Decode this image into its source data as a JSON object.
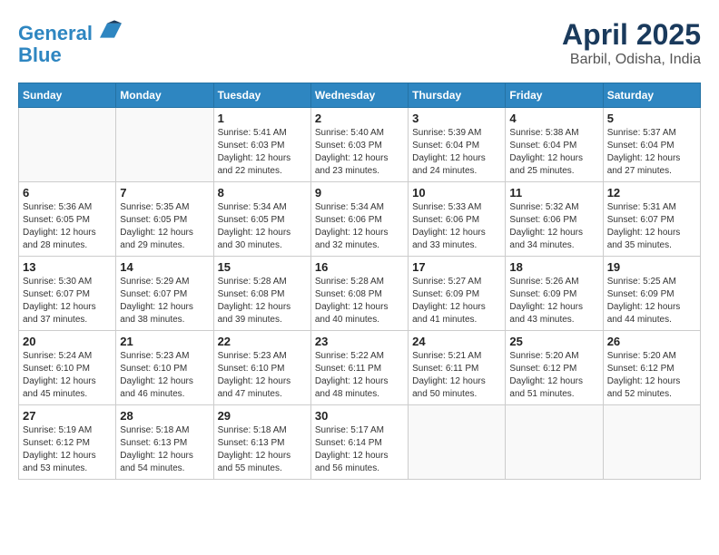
{
  "header": {
    "logo_line1": "General",
    "logo_line2": "Blue",
    "title": "April 2025",
    "subtitle": "Barbil, Odisha, India"
  },
  "weekdays": [
    "Sunday",
    "Monday",
    "Tuesday",
    "Wednesday",
    "Thursday",
    "Friday",
    "Saturday"
  ],
  "weeks": [
    [
      {
        "day": "",
        "info": ""
      },
      {
        "day": "",
        "info": ""
      },
      {
        "day": "1",
        "info": "Sunrise: 5:41 AM\nSunset: 6:03 PM\nDaylight: 12 hours and 22 minutes."
      },
      {
        "day": "2",
        "info": "Sunrise: 5:40 AM\nSunset: 6:03 PM\nDaylight: 12 hours and 23 minutes."
      },
      {
        "day": "3",
        "info": "Sunrise: 5:39 AM\nSunset: 6:04 PM\nDaylight: 12 hours and 24 minutes."
      },
      {
        "day": "4",
        "info": "Sunrise: 5:38 AM\nSunset: 6:04 PM\nDaylight: 12 hours and 25 minutes."
      },
      {
        "day": "5",
        "info": "Sunrise: 5:37 AM\nSunset: 6:04 PM\nDaylight: 12 hours and 27 minutes."
      }
    ],
    [
      {
        "day": "6",
        "info": "Sunrise: 5:36 AM\nSunset: 6:05 PM\nDaylight: 12 hours and 28 minutes."
      },
      {
        "day": "7",
        "info": "Sunrise: 5:35 AM\nSunset: 6:05 PM\nDaylight: 12 hours and 29 minutes."
      },
      {
        "day": "8",
        "info": "Sunrise: 5:34 AM\nSunset: 6:05 PM\nDaylight: 12 hours and 30 minutes."
      },
      {
        "day": "9",
        "info": "Sunrise: 5:34 AM\nSunset: 6:06 PM\nDaylight: 12 hours and 32 minutes."
      },
      {
        "day": "10",
        "info": "Sunrise: 5:33 AM\nSunset: 6:06 PM\nDaylight: 12 hours and 33 minutes."
      },
      {
        "day": "11",
        "info": "Sunrise: 5:32 AM\nSunset: 6:06 PM\nDaylight: 12 hours and 34 minutes."
      },
      {
        "day": "12",
        "info": "Sunrise: 5:31 AM\nSunset: 6:07 PM\nDaylight: 12 hours and 35 minutes."
      }
    ],
    [
      {
        "day": "13",
        "info": "Sunrise: 5:30 AM\nSunset: 6:07 PM\nDaylight: 12 hours and 37 minutes."
      },
      {
        "day": "14",
        "info": "Sunrise: 5:29 AM\nSunset: 6:07 PM\nDaylight: 12 hours and 38 minutes."
      },
      {
        "day": "15",
        "info": "Sunrise: 5:28 AM\nSunset: 6:08 PM\nDaylight: 12 hours and 39 minutes."
      },
      {
        "day": "16",
        "info": "Sunrise: 5:28 AM\nSunset: 6:08 PM\nDaylight: 12 hours and 40 minutes."
      },
      {
        "day": "17",
        "info": "Sunrise: 5:27 AM\nSunset: 6:09 PM\nDaylight: 12 hours and 41 minutes."
      },
      {
        "day": "18",
        "info": "Sunrise: 5:26 AM\nSunset: 6:09 PM\nDaylight: 12 hours and 43 minutes."
      },
      {
        "day": "19",
        "info": "Sunrise: 5:25 AM\nSunset: 6:09 PM\nDaylight: 12 hours and 44 minutes."
      }
    ],
    [
      {
        "day": "20",
        "info": "Sunrise: 5:24 AM\nSunset: 6:10 PM\nDaylight: 12 hours and 45 minutes."
      },
      {
        "day": "21",
        "info": "Sunrise: 5:23 AM\nSunset: 6:10 PM\nDaylight: 12 hours and 46 minutes."
      },
      {
        "day": "22",
        "info": "Sunrise: 5:23 AM\nSunset: 6:10 PM\nDaylight: 12 hours and 47 minutes."
      },
      {
        "day": "23",
        "info": "Sunrise: 5:22 AM\nSunset: 6:11 PM\nDaylight: 12 hours and 48 minutes."
      },
      {
        "day": "24",
        "info": "Sunrise: 5:21 AM\nSunset: 6:11 PM\nDaylight: 12 hours and 50 minutes."
      },
      {
        "day": "25",
        "info": "Sunrise: 5:20 AM\nSunset: 6:12 PM\nDaylight: 12 hours and 51 minutes."
      },
      {
        "day": "26",
        "info": "Sunrise: 5:20 AM\nSunset: 6:12 PM\nDaylight: 12 hours and 52 minutes."
      }
    ],
    [
      {
        "day": "27",
        "info": "Sunrise: 5:19 AM\nSunset: 6:12 PM\nDaylight: 12 hours and 53 minutes."
      },
      {
        "day": "28",
        "info": "Sunrise: 5:18 AM\nSunset: 6:13 PM\nDaylight: 12 hours and 54 minutes."
      },
      {
        "day": "29",
        "info": "Sunrise: 5:18 AM\nSunset: 6:13 PM\nDaylight: 12 hours and 55 minutes."
      },
      {
        "day": "30",
        "info": "Sunrise: 5:17 AM\nSunset: 6:14 PM\nDaylight: 12 hours and 56 minutes."
      },
      {
        "day": "",
        "info": ""
      },
      {
        "day": "",
        "info": ""
      },
      {
        "day": "",
        "info": ""
      }
    ]
  ]
}
